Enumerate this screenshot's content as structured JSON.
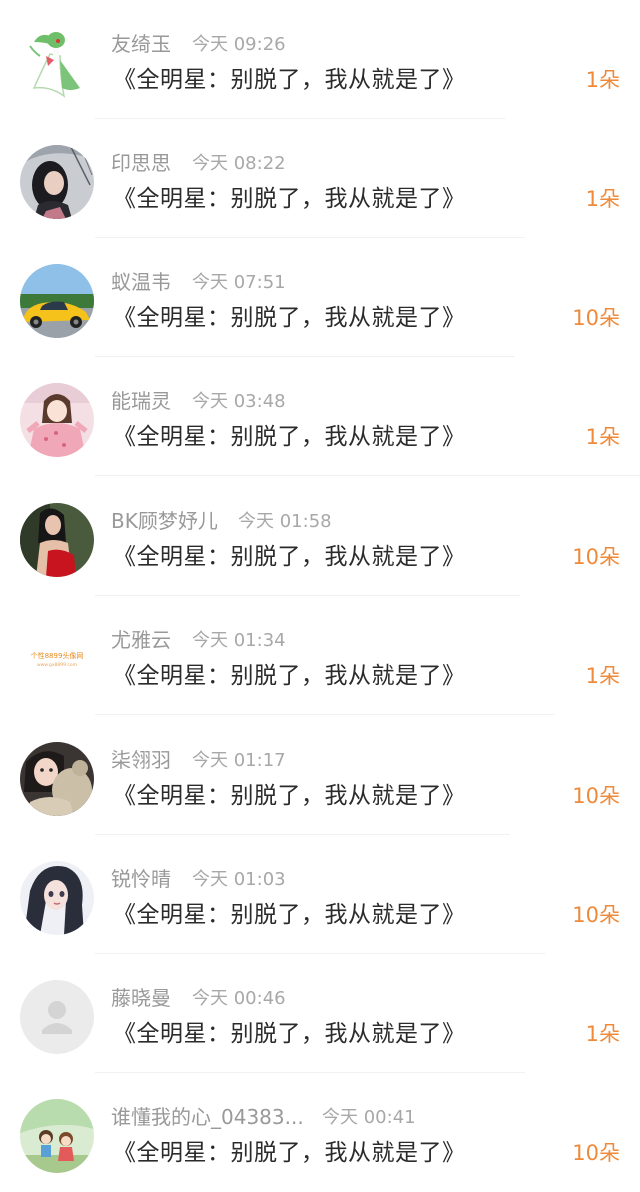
{
  "colors": {
    "username": "#999999",
    "time": "#a8a8a8",
    "message": "#2b2b2b",
    "count": "#ef8a3a",
    "divider": "#f1f1f1"
  },
  "list": {
    "items": [
      {
        "name": "友绮玉",
        "time": "今天 09:26",
        "message": "《全明星：别脱了，我从就是了》",
        "count": "1朵",
        "avatar": "gardevoir-avatar"
      },
      {
        "name": "印思思",
        "time": "今天 08:22",
        "message": "《全明星：别脱了，我从就是了》",
        "count": "1朵",
        "avatar": "girl-umbrella-avatar"
      },
      {
        "name": "蚁温韦",
        "time": "今天 07:51",
        "message": "《全明星：别脱了，我从就是了》",
        "count": "10朵",
        "avatar": "yellow-car-avatar"
      },
      {
        "name": "能瑞灵",
        "time": "今天 03:48",
        "message": "《全明星：别脱了，我从就是了》",
        "count": "1朵",
        "avatar": "cartoon-girl-avatar"
      },
      {
        "name": "BK顾梦妤儿",
        "time": "今天 01:58",
        "message": "《全明星：别脱了，我从就是了》",
        "count": "10朵",
        "avatar": "red-dress-avatar"
      },
      {
        "name": "尤雅云",
        "time": "今天 01:34",
        "message": "《全明星：别脱了，我从就是了》",
        "count": "1朵",
        "avatar": "watermark-avatar",
        "avatar_text": "个性8899头像网",
        "avatar_subtext": "www.gx8899.com"
      },
      {
        "name": "柒翎羽",
        "time": "今天 01:17",
        "message": "《全明星：别脱了，我从就是了》",
        "count": "10朵",
        "avatar": "girl-teddy-avatar"
      },
      {
        "name": "锐怜晴",
        "time": "今天 01:03",
        "message": "《全明星：别脱了，我从就是了》",
        "count": "10朵",
        "avatar": "anime-girl-avatar"
      },
      {
        "name": "藤晓曼",
        "time": "今天 00:46",
        "message": "《全明星：别脱了，我从就是了》",
        "count": "1朵",
        "avatar": "default-user-avatar"
      },
      {
        "name": "谁懂我的心_04383...",
        "time": "今天 00:41",
        "message": "《全明星：别脱了，我从就是了》",
        "count": "10朵",
        "avatar": "cartoon-kids-avatar"
      }
    ]
  }
}
